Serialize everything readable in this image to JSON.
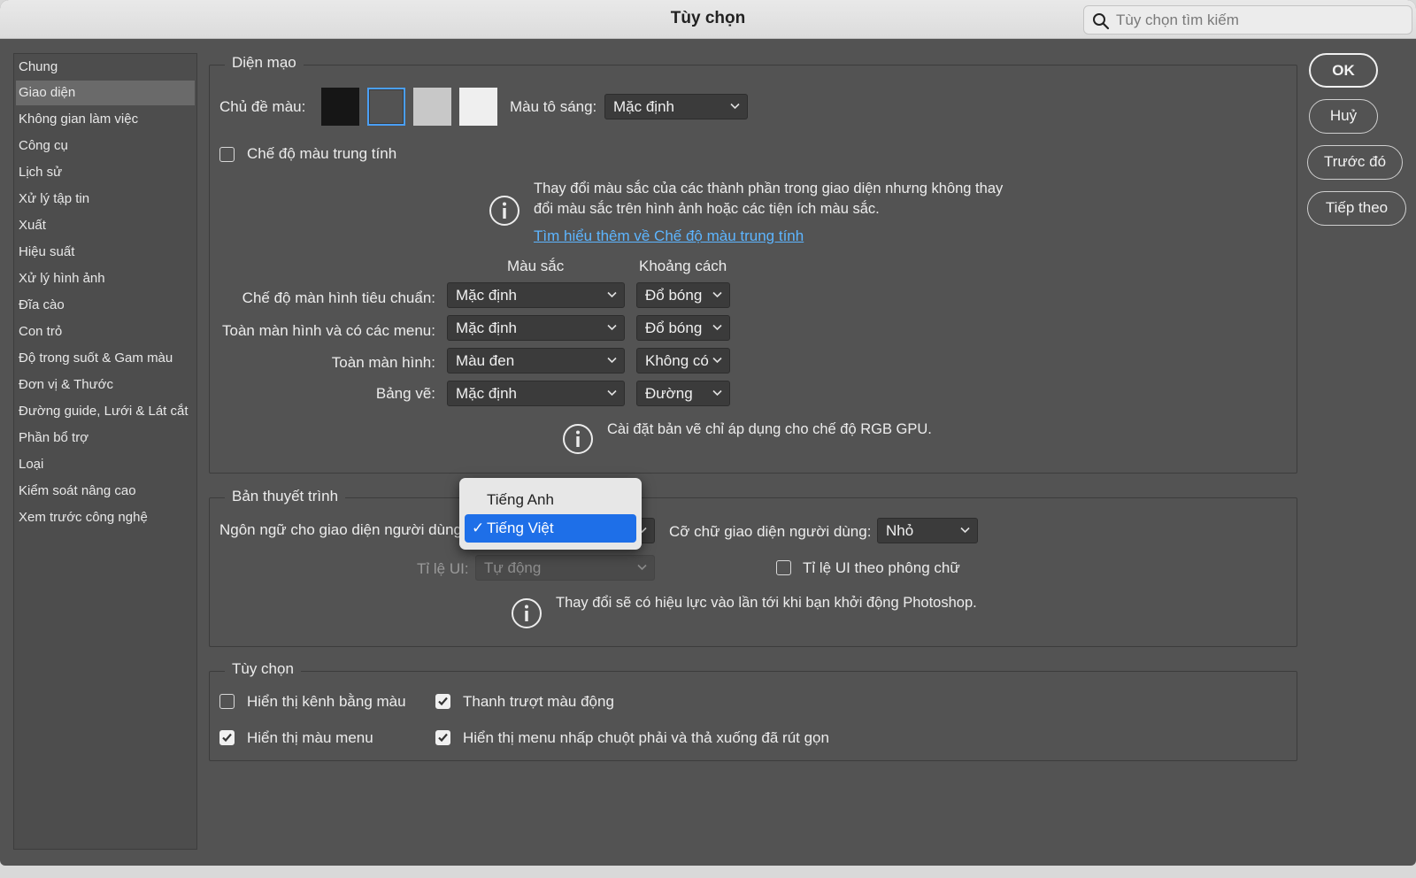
{
  "window": {
    "title": "Tùy chọn"
  },
  "search": {
    "placeholder": "Tùy chọn tìm kiếm"
  },
  "sidebar": {
    "items": [
      {
        "label": "Chung"
      },
      {
        "label": "Giao diện",
        "selected": true
      },
      {
        "label": "Không gian làm việc"
      },
      {
        "label": "Công cụ"
      },
      {
        "label": "Lịch sử"
      },
      {
        "label": "Xử lý tập tin"
      },
      {
        "label": "Xuất"
      },
      {
        "label": "Hiệu suất"
      },
      {
        "label": "Xử lý hình ảnh"
      },
      {
        "label": "Đĩa cào"
      },
      {
        "label": "Con trỏ"
      },
      {
        "label": "Độ trong suốt & Gam màu"
      },
      {
        "label": "Đơn vị & Thước"
      },
      {
        "label": "Đường guide, Lưới & Lát cắt"
      },
      {
        "label": "Phần bổ trợ"
      },
      {
        "label": "Loại"
      },
      {
        "label": "Kiểm soát nâng cao"
      },
      {
        "label": "Xem trước công nghệ"
      }
    ]
  },
  "appearance": {
    "legend": "Diện mạo",
    "color_theme_label": "Chủ đề màu:",
    "swatch_colors": [
      "#161616",
      "#535353",
      "#c8c8c8",
      "#efefef"
    ],
    "selected_swatch_color": "#4a9ff5",
    "highlight_label": "Màu tô sáng:",
    "highlight_value": "Mặc định",
    "neutral_mode_label": "Chế độ màu trung tính",
    "neutral_info": "Thay đổi màu sắc của các thành phần trong giao diện nhưng không thay đổi màu sắc trên hình ảnh hoặc các tiện ích màu sắc.",
    "neutral_link": "Tìm hiểu thêm về Chế độ màu trung tính",
    "col_color": "Màu sắc",
    "col_spacing": "Khoảng cách",
    "rows": [
      {
        "label": "Chế độ màn hình tiêu chuẩn:",
        "color": "Mặc định",
        "spacing": "Đổ bóng"
      },
      {
        "label": "Toàn màn hình và có các menu:",
        "color": "Mặc định",
        "spacing": "Đổ bóng"
      },
      {
        "label": "Toàn màn hình:",
        "color": "Màu đen",
        "spacing": "Không có"
      },
      {
        "label": "Bảng vẽ:",
        "color": "Mặc định",
        "spacing": "Đường"
      }
    ],
    "artboard_info": "Cài đặt bản vẽ chỉ áp dụng cho chế độ RGB GPU."
  },
  "presentation": {
    "legend": "Bản thuyết trình",
    "ui_language_label": "Ngôn ngữ cho giao diện người dùng:",
    "ui_language_options": [
      {
        "label": "Tiếng Anh",
        "selected": false
      },
      {
        "label": "Tiếng Việt",
        "selected": true
      }
    ],
    "checkmark": "✓",
    "ui_font_size_label": "Cỡ chữ giao diện người dùng:",
    "ui_font_size_value": "Nhỏ",
    "ui_scale_label": "Tỉ lệ UI:",
    "ui_scale_value": "Tự động",
    "scale_by_font_label": "Tỉ lệ UI theo phông chữ",
    "restart_info": "Thay đổi sẽ có hiệu lực vào lần tới khi bạn khởi động Photoshop."
  },
  "options": {
    "legend": "Tùy chọn",
    "show_channels_color": {
      "label": "Hiển thị kênh bằng màu",
      "checked": false
    },
    "dynamic_sliders": {
      "label": "Thanh trượt màu động",
      "checked": true
    },
    "show_menu_colors": {
      "label": "Hiển thị màu menu",
      "checked": true
    },
    "condensed_menus": {
      "label": "Hiển thị menu nhấp chuột phải và thả xuống đã rút gọn",
      "checked": true
    }
  },
  "buttons": {
    "ok": "OK",
    "cancel": "Huỷ",
    "prev": "Trước đó",
    "next": "Tiếp theo"
  }
}
